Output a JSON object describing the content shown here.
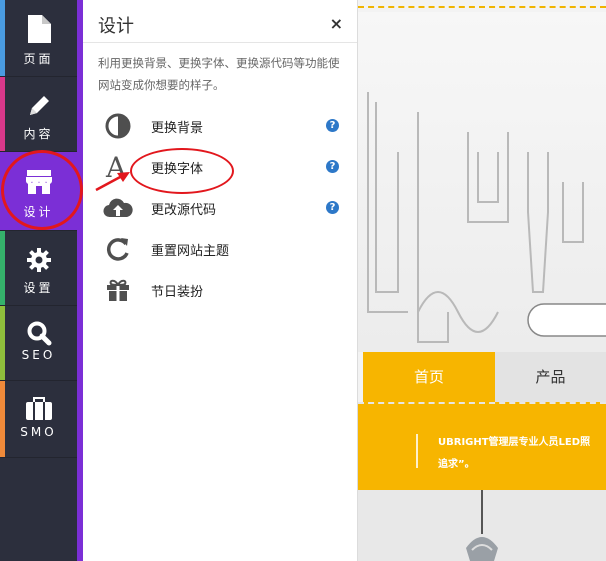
{
  "nav": {
    "items": [
      {
        "label": "页面",
        "icon": "page-icon",
        "bar": "#4a9be0"
      },
      {
        "label": "内容",
        "icon": "pencil-icon",
        "bar": "#d9388a"
      },
      {
        "label": "设计",
        "icon": "store-icon",
        "bar": "#7b2fd6"
      },
      {
        "label": "设置",
        "icon": "gear-icon",
        "bar": "#35b26b"
      },
      {
        "label": "SEO",
        "icon": "search-icon",
        "bar": "#8fbf3c"
      },
      {
        "label": "SMO",
        "icon": "briefcase-icon",
        "bar": "#f08a3a"
      }
    ]
  },
  "panel": {
    "title": "设计",
    "close": "×",
    "description": "利用更换背景、更换字体、更换源代码等功能使网站变成你想要的样子。",
    "items": [
      {
        "label": "更换背景",
        "icon": "contrast-icon",
        "help": "?"
      },
      {
        "label": "更换字体",
        "icon": "font-icon",
        "help": "?"
      },
      {
        "label": "更改源代码",
        "icon": "cloud-upload-icon",
        "help": "?"
      },
      {
        "label": "重置网站主题",
        "icon": "reset-icon"
      },
      {
        "label": "节日装扮",
        "icon": "gift-icon"
      }
    ]
  },
  "preview": {
    "nav_home": "首页",
    "nav_product": "产品",
    "band_text_1": "UBRIGHT管理层专业人员LED照",
    "band_text_2": "追求”。"
  },
  "colors": {
    "accent": "#7b2fd6",
    "brand_yellow": "#f7b500",
    "annotation_red": "#e2171d"
  }
}
